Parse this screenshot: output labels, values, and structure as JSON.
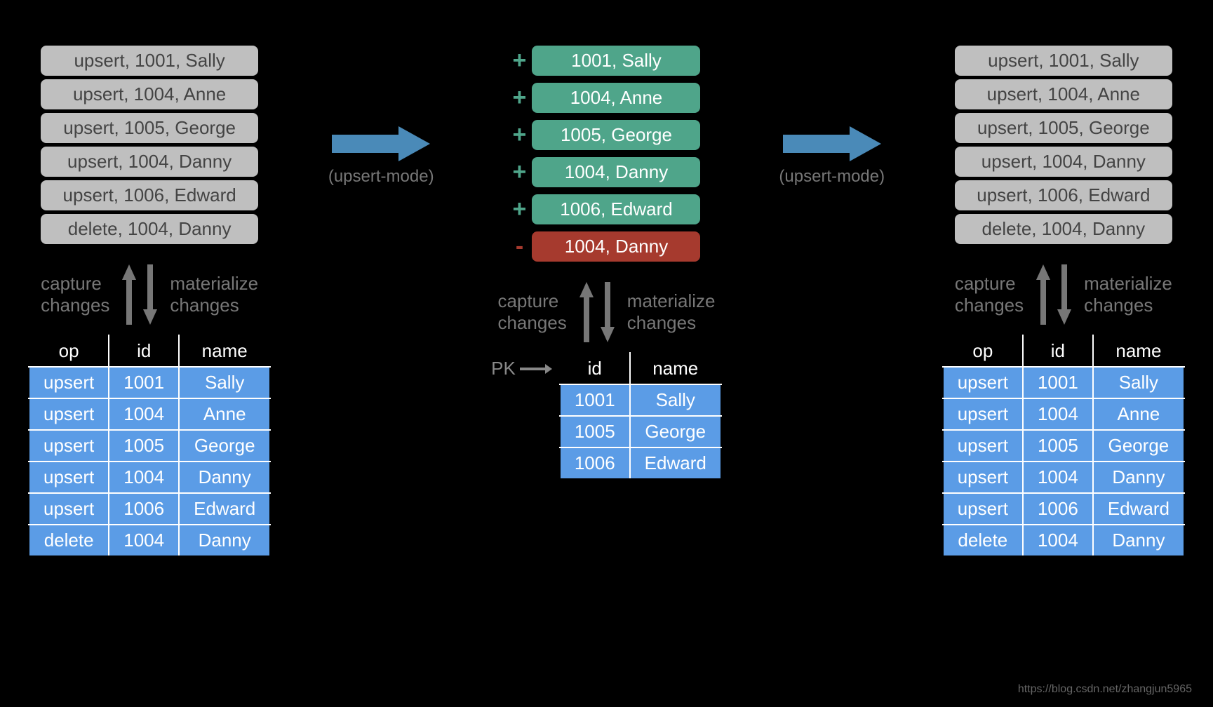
{
  "left": {
    "pills": [
      "upsert, 1001, Sally",
      "upsert, 1004, Anne",
      "upsert, 1005, George",
      "upsert, 1004, Danny",
      "upsert, 1006, Edward",
      "delete, 1004, Danny"
    ],
    "capture": "capture\nchanges",
    "materialize": "materialize\nchanges",
    "table": {
      "headers": [
        "op",
        "id",
        "name"
      ],
      "rows": [
        [
          "upsert",
          "1001",
          "Sally"
        ],
        [
          "upsert",
          "1004",
          "Anne"
        ],
        [
          "upsert",
          "1005",
          "George"
        ],
        [
          "upsert",
          "1004",
          "Danny"
        ],
        [
          "upsert",
          "1006",
          "Edward"
        ],
        [
          "delete",
          "1004",
          "Danny"
        ]
      ]
    }
  },
  "arrow1": {
    "label": "(upsert-mode)"
  },
  "middle": {
    "items": [
      {
        "sign": "+",
        "text": "1001, Sally",
        "kind": "green"
      },
      {
        "sign": "+",
        "text": "1004, Anne",
        "kind": "green"
      },
      {
        "sign": "+",
        "text": "1005, George",
        "kind": "green"
      },
      {
        "sign": "+",
        "text": "1004, Danny",
        "kind": "green"
      },
      {
        "sign": "+",
        "text": "1006, Edward",
        "kind": "green"
      },
      {
        "sign": "-",
        "text": "1004, Danny",
        "kind": "red"
      }
    ],
    "capture": "capture\nchanges",
    "materialize": "materialize\nchanges",
    "pk_label": "PK",
    "table": {
      "headers": [
        "id",
        "name"
      ],
      "rows": [
        [
          "1001",
          "Sally"
        ],
        [
          "1005",
          "George"
        ],
        [
          "1006",
          "Edward"
        ]
      ]
    }
  },
  "arrow2": {
    "label": "(upsert-mode)"
  },
  "right": {
    "pills": [
      "upsert, 1001, Sally",
      "upsert, 1004, Anne",
      "upsert, 1005, George",
      "upsert, 1004, Danny",
      "upsert, 1006, Edward",
      "delete, 1004, Danny"
    ],
    "capture": "capture\nchanges",
    "materialize": "materialize\nchanges",
    "table": {
      "headers": [
        "op",
        "id",
        "name"
      ],
      "rows": [
        [
          "upsert",
          "1001",
          "Sally"
        ],
        [
          "upsert",
          "1004",
          "Anne"
        ],
        [
          "upsert",
          "1005",
          "George"
        ],
        [
          "upsert",
          "1004",
          "Danny"
        ],
        [
          "upsert",
          "1006",
          "Edward"
        ],
        [
          "delete",
          "1004",
          "Danny"
        ]
      ]
    }
  },
  "watermark": "https://blog.csdn.net/zhangjun5965"
}
